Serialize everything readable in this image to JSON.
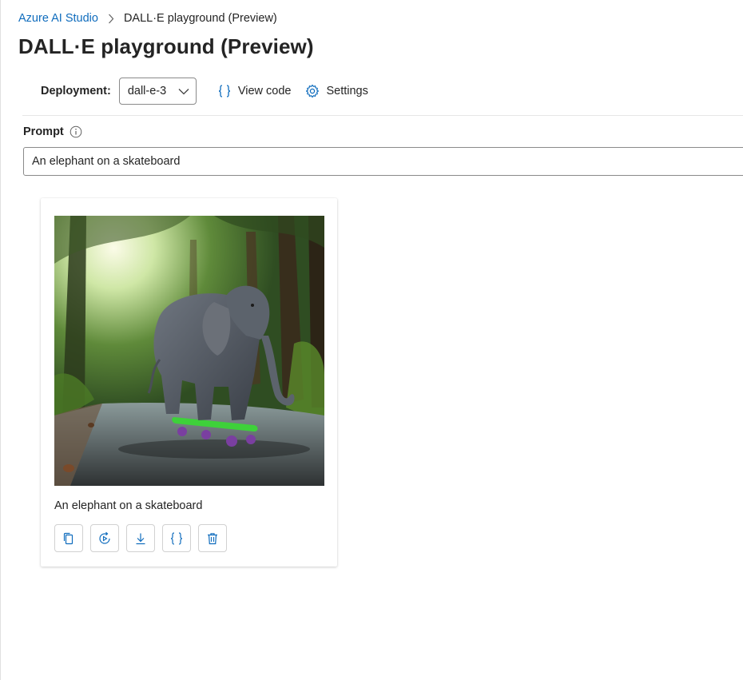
{
  "breadcrumb": {
    "root": "Azure AI Studio",
    "current": "DALL·E playground (Preview)"
  },
  "page": {
    "title": "DALL·E playground (Preview)"
  },
  "toolbar": {
    "deployment_label": "Deployment:",
    "deployment_value": "dall-e-3",
    "view_code_label": "View code",
    "settings_label": "Settings"
  },
  "prompt": {
    "label": "Prompt",
    "value": "An elephant on a skateboard"
  },
  "result": {
    "caption": "An elephant on a skateboard",
    "actions": [
      "copy-icon",
      "regenerate-icon",
      "download-icon",
      "code-braces-icon",
      "delete-icon"
    ]
  },
  "colors": {
    "accent": "#0f6cbd",
    "text": "#242424",
    "border": "#8a8a8a"
  }
}
